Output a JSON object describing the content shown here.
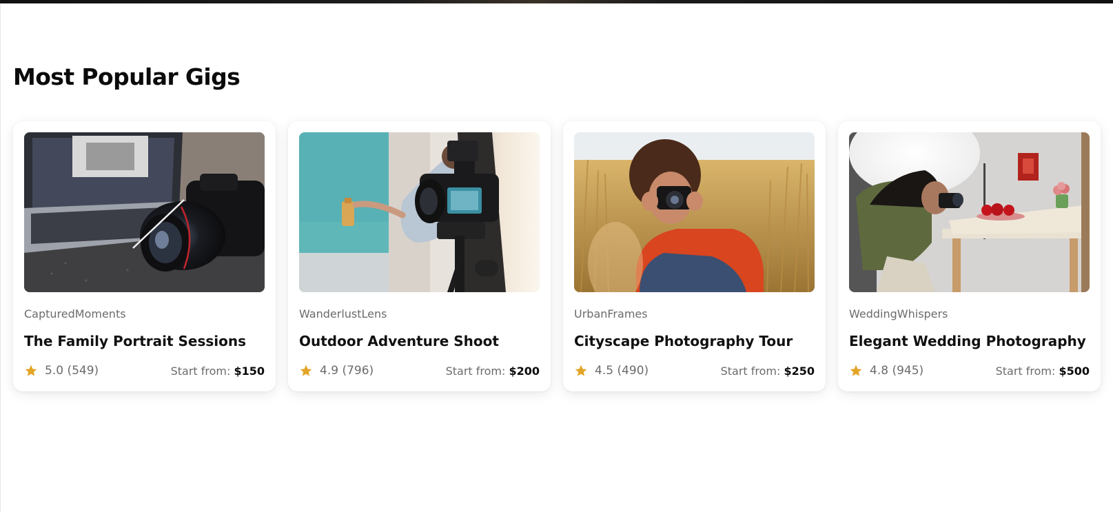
{
  "section": {
    "title": "Most Popular Gigs"
  },
  "price_prefix": "Start from:",
  "star_color": "#E2A526",
  "cards": [
    {
      "seller": "CapturedMoments",
      "title": "The Family Portrait Sessions",
      "rating": "5.0",
      "reviews": "(549)",
      "price": "$150",
      "image": "camera-on-desk-photo"
    },
    {
      "seller": "WanderlustLens",
      "title": "Outdoor Adventure Shoot",
      "rating": "4.9",
      "reviews": "(796)",
      "price": "$200",
      "image": "studio-camera-tripod-photo"
    },
    {
      "seller": "UrbanFrames",
      "title": "Cityscape Photography Tour",
      "rating": "4.5",
      "reviews": "(490)",
      "price": "$250",
      "image": "photographer-in-wheat-field-photo"
    },
    {
      "seller": "WeddingWhispers",
      "title": "Elegant Wedding Photography",
      "rating": "4.8",
      "reviews": "(945)",
      "price": "$500",
      "image": "photographer-shooting-apples-photo"
    }
  ]
}
